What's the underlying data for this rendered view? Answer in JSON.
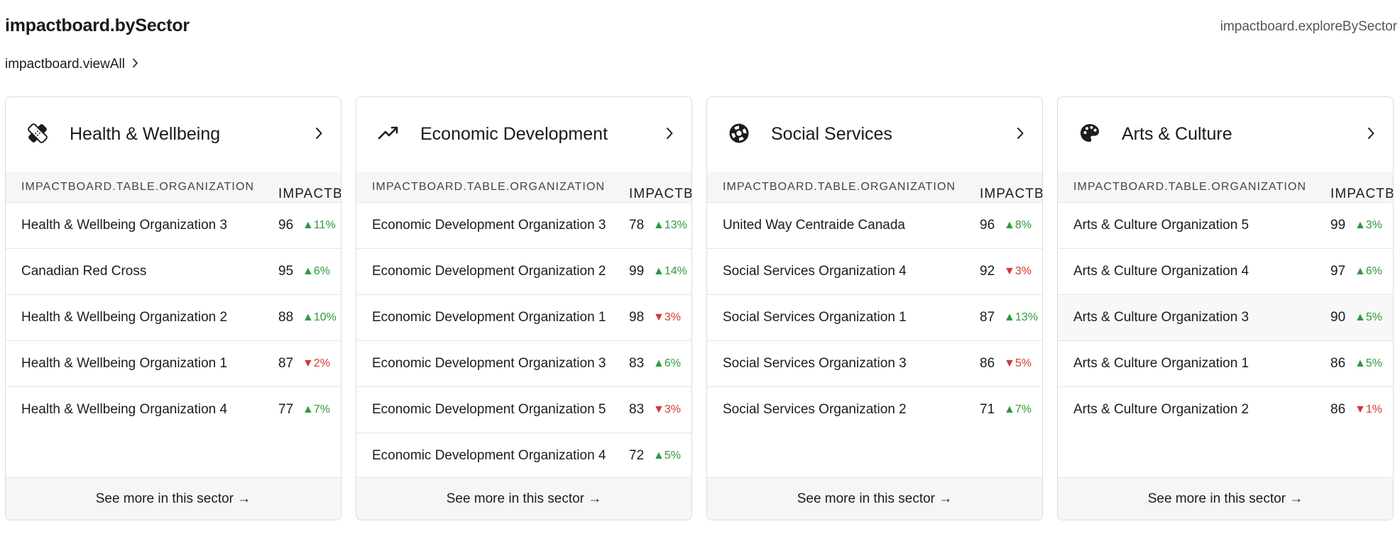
{
  "header": {
    "title": "impactboard.bySector",
    "explore_link": "impactboard.exploreBySector",
    "view_all": "impactboard.viewAll"
  },
  "table_headers": {
    "organization": "IMPACTBOARD.TABLE.ORGANIZATION",
    "score": "IMPACTBOARD.TABLE.SCORE"
  },
  "colors": {
    "up": "#2e9a3e",
    "down": "#d03a36"
  },
  "sectors": [
    {
      "name": "Health & Wellbeing",
      "icon": "bandage-icon",
      "footer": "See more in this sector →",
      "rows": [
        {
          "org": "Health & Wellbeing Organization 3",
          "score": "96",
          "delta": "▲11%",
          "dir": "up"
        },
        {
          "org": "Canadian Red Cross",
          "score": "95",
          "delta": "▲6%",
          "dir": "up"
        },
        {
          "org": "Health & Wellbeing Organization 2",
          "score": "88",
          "delta": "▲10%",
          "dir": "up"
        },
        {
          "org": "Health & Wellbeing Organization 1",
          "score": "87",
          "delta": "▼2%",
          "dir": "down"
        },
        {
          "org": "Health & Wellbeing Organization 4",
          "score": "77",
          "delta": "▲7%",
          "dir": "up"
        }
      ]
    },
    {
      "name": "Economic Development",
      "icon": "trending-up-icon",
      "footer": "See more in this sector →",
      "rows": [
        {
          "org": "Economic Development Organization 3",
          "score": "78",
          "delta": "▲13%",
          "dir": "up"
        },
        {
          "org": "Economic Development Organization 2",
          "score": "99",
          "delta": "▲14%",
          "dir": "up"
        },
        {
          "org": "Economic Development Organization 1",
          "score": "98",
          "delta": "▼3%",
          "dir": "down"
        },
        {
          "org": "Economic Development Organization 3",
          "score": "83",
          "delta": "▲6%",
          "dir": "up"
        },
        {
          "org": "Economic Development Organization 5",
          "score": "83",
          "delta": "▼3%",
          "dir": "down"
        },
        {
          "org": "Economic Development Organization 4",
          "score": "72",
          "delta": "▲5%",
          "dir": "up"
        }
      ]
    },
    {
      "name": "Social Services",
      "icon": "lifebuoy-icon",
      "footer": "See more in this sector →",
      "rows": [
        {
          "org": "United Way Centraide Canada",
          "score": "96",
          "delta": "▲8%",
          "dir": "up"
        },
        {
          "org": "Social Services Organization 4",
          "score": "92",
          "delta": "▼3%",
          "dir": "down"
        },
        {
          "org": "Social Services Organization 1",
          "score": "87",
          "delta": "▲13%",
          "dir": "up"
        },
        {
          "org": "Social Services Organization 3",
          "score": "86",
          "delta": "▼5%",
          "dir": "down"
        },
        {
          "org": "Social Services Organization 2",
          "score": "71",
          "delta": "▲7%",
          "dir": "up"
        }
      ]
    },
    {
      "name": "Arts & Culture",
      "icon": "palette-icon",
      "footer": "See more in this sector →",
      "highlight_row": 2,
      "rows": [
        {
          "org": "Arts & Culture Organization 5",
          "score": "99",
          "delta": "▲3%",
          "dir": "up"
        },
        {
          "org": "Arts & Culture Organization 4",
          "score": "97",
          "delta": "▲6%",
          "dir": "up"
        },
        {
          "org": "Arts & Culture Organization 3",
          "score": "90",
          "delta": "▲5%",
          "dir": "up"
        },
        {
          "org": "Arts & Culture Organization 1",
          "score": "86",
          "delta": "▲5%",
          "dir": "up"
        },
        {
          "org": "Arts & Culture Organization 2",
          "score": "86",
          "delta": "▼1%",
          "dir": "down"
        }
      ]
    }
  ]
}
